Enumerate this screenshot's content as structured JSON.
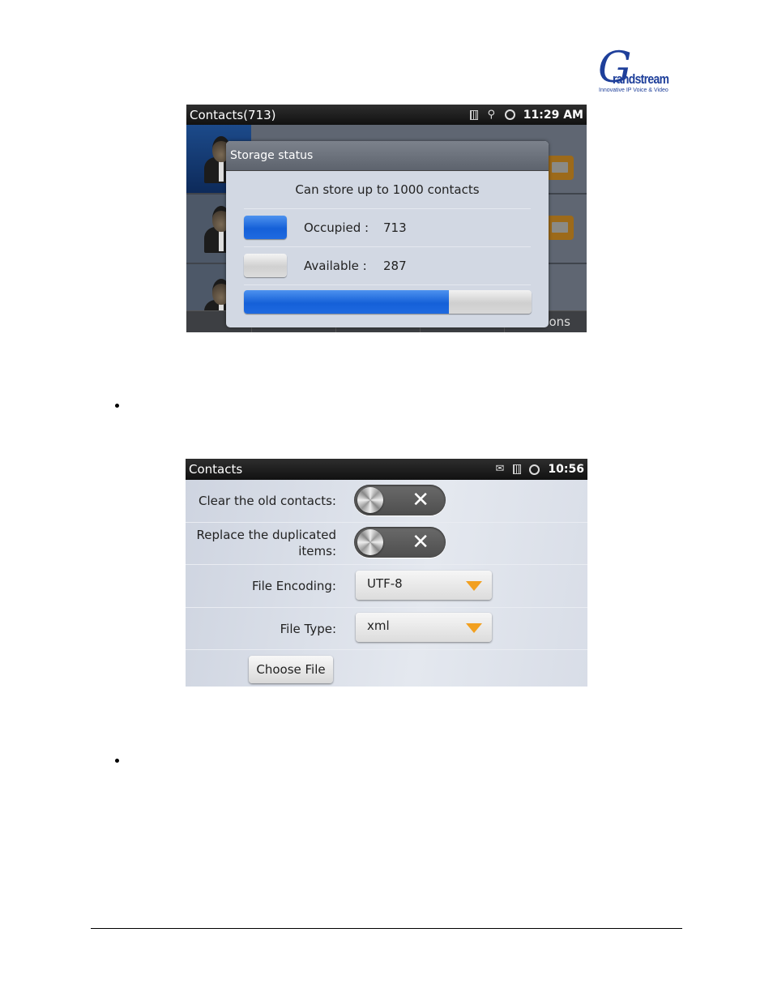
{
  "logo": {
    "letter": "G",
    "word": "randstream",
    "tagline": "Innovative IP Voice & Video"
  },
  "screenshot1": {
    "statusbar": {
      "title": "Contacts(713)",
      "icons": [
        "sim-card-icon",
        "usb-icon",
        "sync-icon"
      ],
      "time": "11:29 AM"
    },
    "background_label": "ons",
    "dialog": {
      "title": "Storage status",
      "caption": "Can store up to 1000 contacts",
      "occupied_label": "Occupied :",
      "occupied_value": "713",
      "available_label": "Available :",
      "available_value": "287",
      "progress_fraction": 0.713
    },
    "colors": {
      "occupied": "#1f6ae0",
      "available": "#d0d0d0"
    }
  },
  "screenshot2": {
    "statusbar": {
      "title": "Contacts",
      "icons": [
        "message-icon",
        "sim-card-icon",
        "sync-icon"
      ],
      "time": "10:56"
    },
    "form": {
      "clear_old_label": "Clear the old contacts:",
      "clear_old_state": "off",
      "replace_dup_label_line1": "Replace the duplicated",
      "replace_dup_label_line2": "items:",
      "replace_dup_state": "off",
      "toggle_off_glyph": "✕",
      "encoding_label": "File Encoding:",
      "encoding_value": "UTF-8",
      "file_type_label": "File Type:",
      "file_type_value": "xml",
      "choose_file_label": "Choose File"
    }
  },
  "bullets": [
    "",
    ""
  ]
}
